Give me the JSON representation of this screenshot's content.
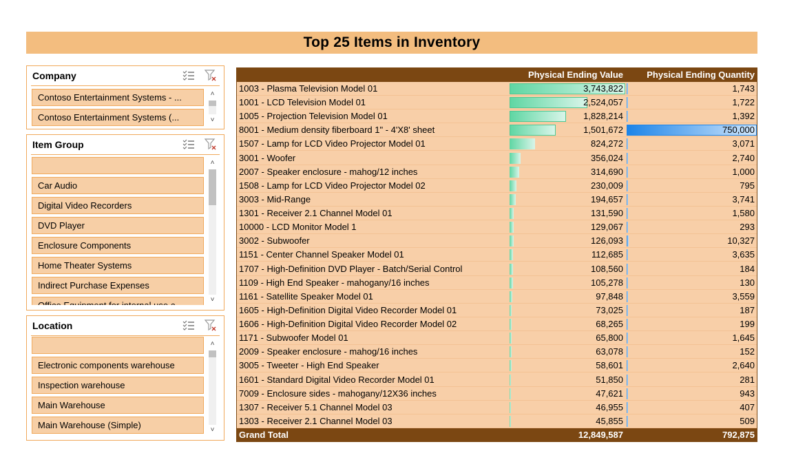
{
  "title": "Top 25 Items in Inventory",
  "colors": {
    "title_bg": "#f3bd7f",
    "header_bg": "#7b4712",
    "row_bg": "#f8cfa8",
    "slicer_item": "#f7cfa6",
    "value_bar": "#5fd6a3",
    "qty_bar": "#1c84e8"
  },
  "slicers": {
    "company": {
      "title": "Company",
      "icons": [
        "multi-select-icon",
        "clear-filter-icon"
      ],
      "items": [
        "Contoso Entertainment Systems - ...",
        "Contoso Entertainment Systems (..."
      ]
    },
    "item_group": {
      "title": "Item Group",
      "icons": [
        "multi-select-icon",
        "clear-filter-icon"
      ],
      "items": [
        "",
        "Car Audio",
        "Digital Video Recorders",
        "DVD Player",
        "Enclosure Components",
        "Home Theater Systems",
        "Indirect Purchase Expenses",
        "Office Equipment for internal use a..."
      ]
    },
    "location": {
      "title": "Location",
      "icons": [
        "multi-select-icon",
        "clear-filter-icon"
      ],
      "items": [
        "",
        "Electronic components warehouse",
        "Inspection warehouse",
        "Main Warehouse",
        "Main Warehouse (Simple)"
      ]
    }
  },
  "pivot": {
    "headers": {
      "item": "",
      "value": "Physical Ending Value",
      "quantity": "Physical Ending Quantity"
    },
    "rows": [
      {
        "item": "1003 - Plasma Television Model 01",
        "value": "3,743,822",
        "quantity": "1,743",
        "v": 3743822,
        "q": 1743
      },
      {
        "item": "1001 - LCD Television Model 01",
        "value": "2,524,057",
        "quantity": "1,722",
        "v": 2524057,
        "q": 1722
      },
      {
        "item": "1005 - Projection Television Model 01",
        "value": "1,828,214",
        "quantity": "1,392",
        "v": 1828214,
        "q": 1392
      },
      {
        "item": "8001 - Medium density fiberboard 1\" - 4'X8' sheet",
        "value": "1,501,672",
        "quantity": "750,000",
        "v": 1501672,
        "q": 750000
      },
      {
        "item": "1507 - Lamp for LCD Video Projector Model 01",
        "value": "824,272",
        "quantity": "3,071",
        "v": 824272,
        "q": 3071
      },
      {
        "item": "3001 - Woofer",
        "value": "356,024",
        "quantity": "2,740",
        "v": 356024,
        "q": 2740
      },
      {
        "item": "2007 - Speaker enclosure - mahog/12 inches",
        "value": "314,690",
        "quantity": "1,000",
        "v": 314690,
        "q": 1000
      },
      {
        "item": "1508 - Lamp for LCD Video Projector Model 02",
        "value": "230,009",
        "quantity": "795",
        "v": 230009,
        "q": 795
      },
      {
        "item": "3003 - Mid-Range",
        "value": "194,657",
        "quantity": "3,741",
        "v": 194657,
        "q": 3741
      },
      {
        "item": "1301 - Receiver 2.1 Channel Model 01",
        "value": "131,590",
        "quantity": "1,580",
        "v": 131590,
        "q": 1580
      },
      {
        "item": "10000 - LCD Monitor Model 1",
        "value": "129,067",
        "quantity": "293",
        "v": 129067,
        "q": 293
      },
      {
        "item": "3002 - Subwoofer",
        "value": "126,093",
        "quantity": "10,327",
        "v": 126093,
        "q": 10327
      },
      {
        "item": "1151 - Center Channel Speaker Model 01",
        "value": "112,685",
        "quantity": "3,635",
        "v": 112685,
        "q": 3635
      },
      {
        "item": "1707 - High-Definition DVD Player - Batch/Serial Control",
        "value": "108,560",
        "quantity": "184",
        "v": 108560,
        "q": 184
      },
      {
        "item": "1109 - High End Speaker - mahogany/16 inches",
        "value": "105,278",
        "quantity": "130",
        "v": 105278,
        "q": 130
      },
      {
        "item": "1161 - Satellite Speaker Model 01",
        "value": "97,848",
        "quantity": "3,559",
        "v": 97848,
        "q": 3559
      },
      {
        "item": "1605 - High-Definition Digital Video Recorder Model 01",
        "value": "73,025",
        "quantity": "187",
        "v": 73025,
        "q": 187
      },
      {
        "item": "1606 - High-Definition Digital Video Recorder Model 02",
        "value": "68,265",
        "quantity": "199",
        "v": 68265,
        "q": 199
      },
      {
        "item": "1171 - Subwoofer Model 01",
        "value": "65,800",
        "quantity": "1,645",
        "v": 65800,
        "q": 1645
      },
      {
        "item": "2009 - Speaker enclosure - mahog/16 inches",
        "value": "63,078",
        "quantity": "152",
        "v": 63078,
        "q": 152
      },
      {
        "item": "3005 - Tweeter - High End Speaker",
        "value": "58,601",
        "quantity": "2,640",
        "v": 58601,
        "q": 2640
      },
      {
        "item": "1601 - Standard Digital Video Recorder Model 01",
        "value": "51,850",
        "quantity": "281",
        "v": 51850,
        "q": 281
      },
      {
        "item": "7009 - Enclosure sides - mahogany/12X36 inches",
        "value": "47,621",
        "quantity": "943",
        "v": 47621,
        "q": 943
      },
      {
        "item": "1307 - Receiver 5.1 Channel Model 03",
        "value": "46,955",
        "quantity": "407",
        "v": 46955,
        "q": 407
      },
      {
        "item": "1303 - Receiver 2.1 Channel Model 03",
        "value": "45,855",
        "quantity": "509",
        "v": 45855,
        "q": 509
      }
    ],
    "total": {
      "label": "Grand Total",
      "value": "12,849,587",
      "quantity": "792,875"
    }
  }
}
